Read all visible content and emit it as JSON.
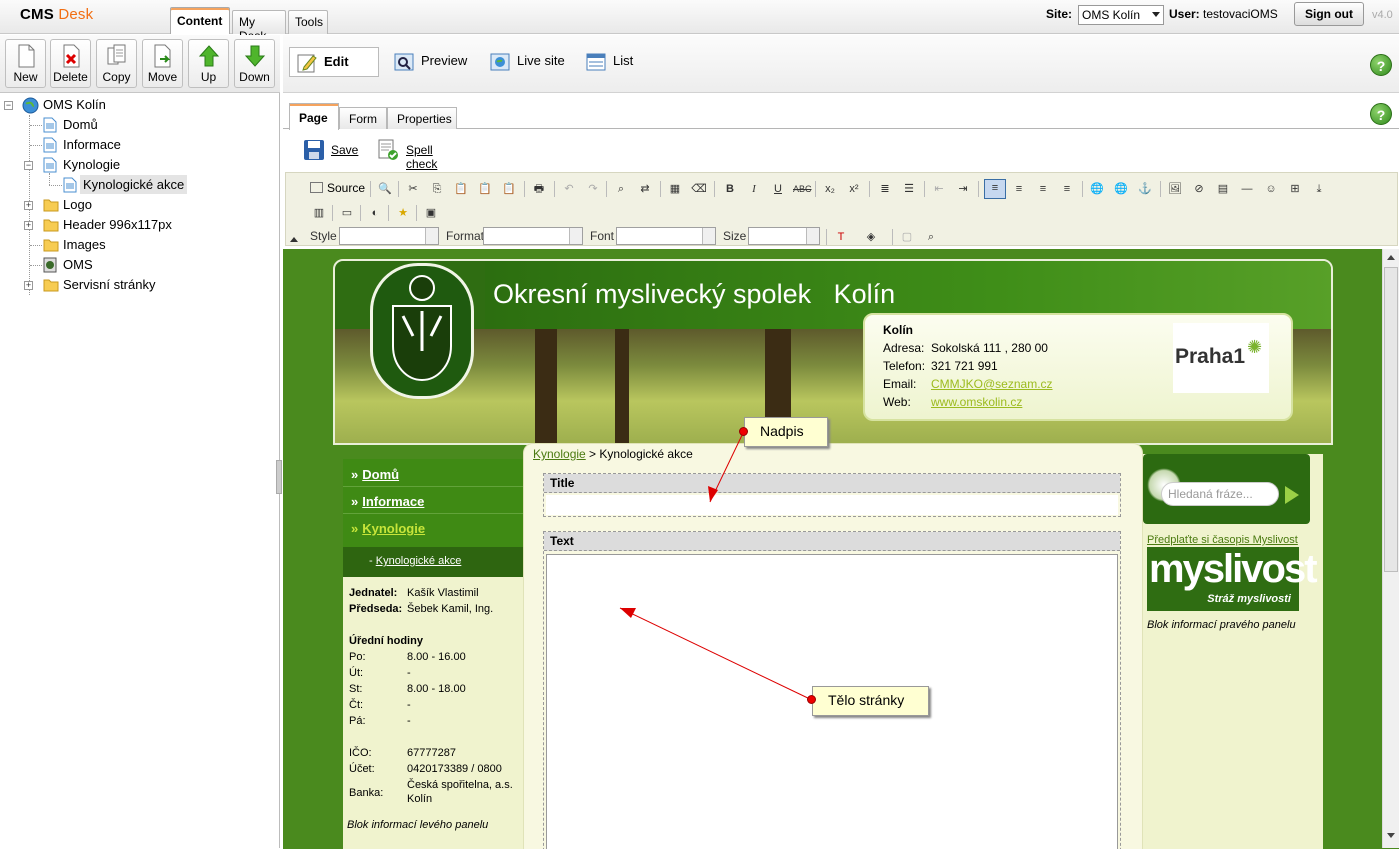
{
  "app": {
    "brand_cms": "CMS",
    "brand_desk": "Desk",
    "version": "v4.0"
  },
  "top_tabs": [
    {
      "label": "Content",
      "active": true
    },
    {
      "label": "My Desk",
      "active": false
    },
    {
      "label": "Tools",
      "active": false
    }
  ],
  "site": {
    "site_label": "Site:",
    "site_value": "OMS Kolín",
    "user_label": "User:",
    "user_value": "testovaciOMS",
    "signout": "Sign out"
  },
  "left_toolbar": [
    "New",
    "Delete",
    "Copy",
    "Move",
    "Up",
    "Down"
  ],
  "tree": [
    {
      "label": "OMS Kolín",
      "icon": "globe-icon"
    },
    {
      "label": "Domů",
      "icon": "page-icon"
    },
    {
      "label": "Informace",
      "icon": "page-icon"
    },
    {
      "label": "Kynologie",
      "icon": "page-icon"
    },
    {
      "label": "Kynologické akce",
      "icon": "page-icon",
      "selected": true
    },
    {
      "label": "Logo",
      "icon": "folder-icon"
    },
    {
      "label": "Header 996x117px",
      "icon": "folder-icon"
    },
    {
      "label": "Images",
      "icon": "folder-icon"
    },
    {
      "label": "OMS",
      "icon": "oms-icon"
    },
    {
      "label": "Servisní stránky",
      "icon": "folder-icon"
    }
  ],
  "view_modes": [
    {
      "label": "Edit",
      "active": true
    },
    {
      "label": "Preview"
    },
    {
      "label": "Live site"
    },
    {
      "label": "List"
    }
  ],
  "sub_tabs": [
    {
      "label": "Page",
      "active": true
    },
    {
      "label": "Form"
    },
    {
      "label": "Properties"
    }
  ],
  "actions": {
    "save": "Save",
    "spell": "Spell check"
  },
  "editor": {
    "source": "Source",
    "style": "Style",
    "format": "Format",
    "font": "Font",
    "size": "Size"
  },
  "site_page": {
    "title": "Okresní myslivecký spolek   Kolín",
    "contact": {
      "name": "Kolín",
      "address_label": "Adresa:",
      "address": "Sokolská 111 , 280 00",
      "phone_label": "Telefon:",
      "phone": "321 721 991",
      "email_label": "Email:",
      "email": "CMMJKO@seznam.cz",
      "web_label": "Web:",
      "web": "www.omskolin.cz"
    },
    "praha": "Praha1",
    "nav": [
      "Domů",
      "Informace",
      "Kynologie"
    ],
    "subnav": "Kynologické akce",
    "info": [
      {
        "k": "Jednatel:",
        "v": "Kašík Vlastimil"
      },
      {
        "k": "Předseda:",
        "v": "Šebek Kamil, Ing."
      }
    ],
    "hours_title": "Úřední hodiny",
    "hours": [
      {
        "k": "Po:",
        "v": "8.00 - 16.00"
      },
      {
        "k": "Út:",
        "v": "-"
      },
      {
        "k": "St:",
        "v": "8.00 - 18.00"
      },
      {
        "k": "Čt:",
        "v": "-"
      },
      {
        "k": "Pá:",
        "v": "-"
      }
    ],
    "ids": [
      {
        "k": "IČO:",
        "v": "67777287"
      },
      {
        "k": "Účet:",
        "v": "0420173389 / 0800"
      },
      {
        "k": "Banka:",
        "v": "Česká spořitelna, a.s."
      },
      {
        "k": "",
        "v": "Kolín"
      }
    ],
    "left_note": "Blok informací levého panelu",
    "breadcrumb_link": "Kynologie",
    "breadcrumb_rest": " > Kynologické akce",
    "field_title": "Title",
    "field_text": "Text",
    "search_placeholder": "Hledaná fráze...",
    "subscribe": "Předplaťte si časopis Myslivost",
    "myslivost": "myslivost",
    "myslivost_sub": "Stráž myslivosti",
    "right_note": "Blok informací pravého panelu"
  },
  "callouts": {
    "heading": "Nadpis",
    "body": "Tělo stránky"
  }
}
